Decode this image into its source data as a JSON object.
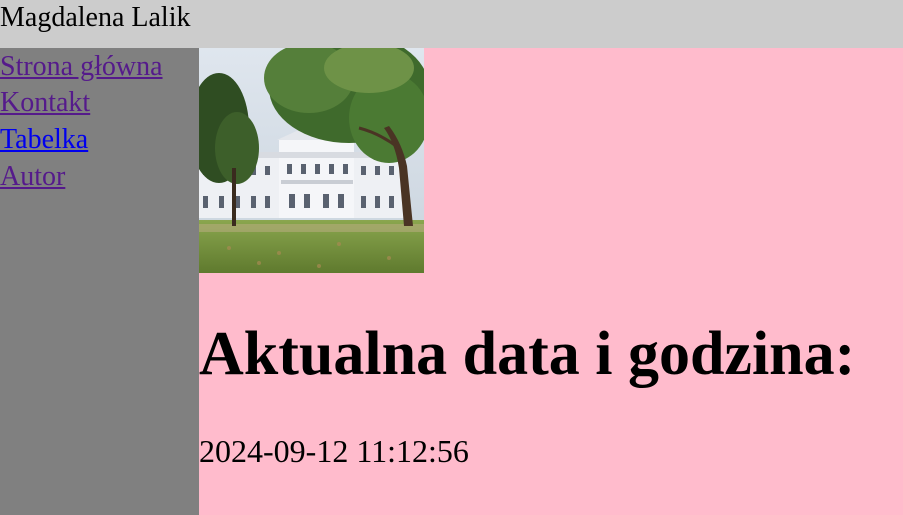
{
  "header": {
    "title": "Magdalena Lalik"
  },
  "sidebar": {
    "links": [
      {
        "label": "Strona główna",
        "state": "visited"
      },
      {
        "label": "Kontakt",
        "state": "visited"
      },
      {
        "label": "Tabelka",
        "state": "unvisited"
      },
      {
        "label": "Autor",
        "state": "visited"
      }
    ]
  },
  "main": {
    "image": {
      "description_icon": "palace-photo"
    },
    "heading": "Aktualna data i godzina:",
    "datetime": "2024-09-12 11:12:56"
  },
  "colors": {
    "header_bg": "#cccccc",
    "sidebar_bg": "#808080",
    "main_bg": "#ffbbcc",
    "link_visited": "#551a8b",
    "link_unvisited": "#0000ee"
  }
}
